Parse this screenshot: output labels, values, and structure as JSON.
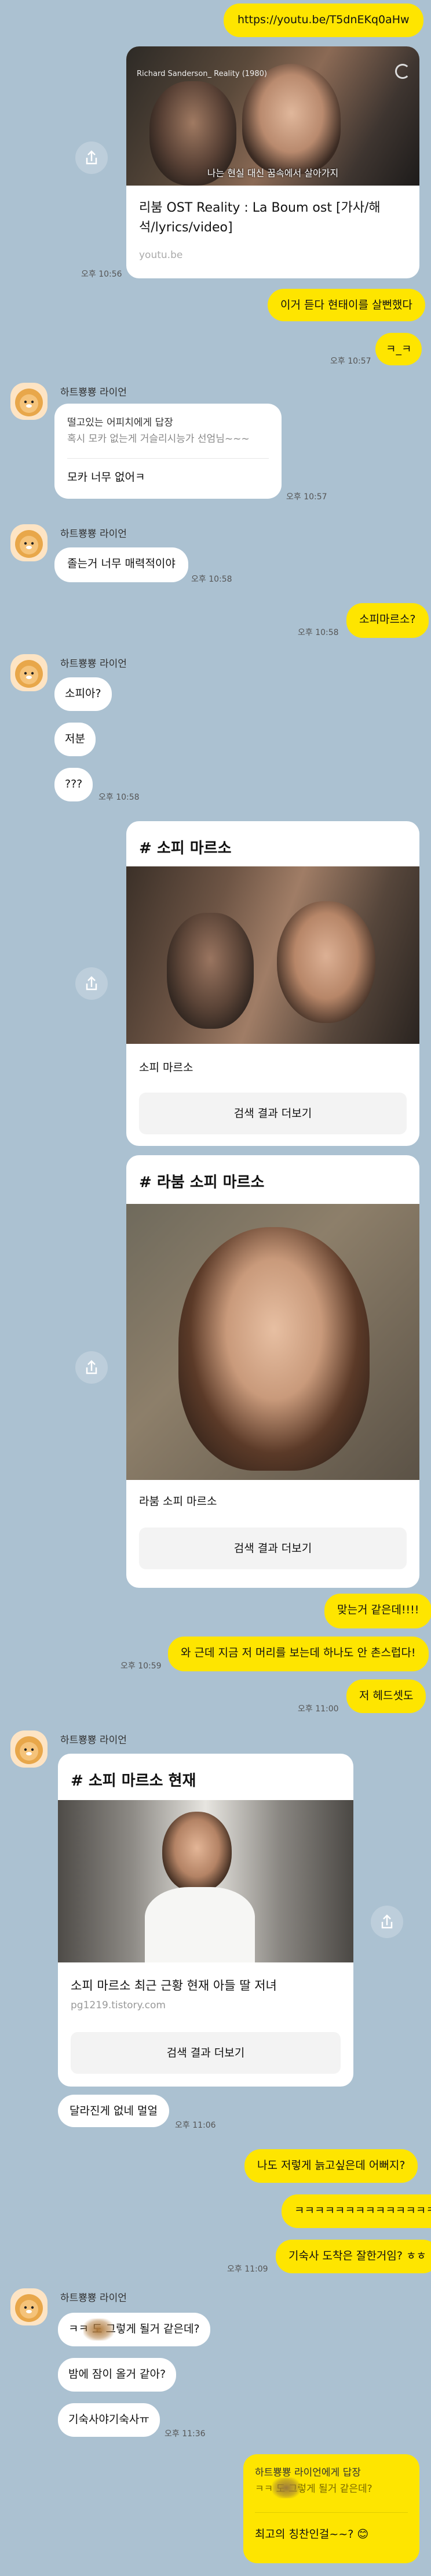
{
  "link_msg": {
    "url": "https://youtu.be/T5dnEKq0aHw",
    "video_overlay": "Richard Sanderson_ Reality (1980)",
    "subtitle": "나는 현실 대신 꿈속에서 살아가지",
    "title": "리붐 OST Reality : La Boum ost [가사/해석/lyrics/video]",
    "domain": "youtu.be",
    "time": "오후 10:56"
  },
  "msg_boom": {
    "text": "이거 듣다 현태이를 살뻔했다",
    "time": ""
  },
  "msg_kk": {
    "text": "ㅋ_ㅋ",
    "time": "오후 10:57"
  },
  "sender_name": "하트뿅뿅 라이언",
  "reply1": {
    "header": "떨고있는 어피치에게 답장",
    "quoted": "혹시 모카 없는게 거슬리시능가 선엄님~~~",
    "text": "모카 너무 없어ㅋ",
    "time": "오후 10:57"
  },
  "msg_charm": {
    "text": "졸는거 너무 매력적이야",
    "time": "오후 10:58"
  },
  "msg_sophie_q": {
    "text": "소피마르소?",
    "time": "오후 10:58"
  },
  "msg_sophia": {
    "text": "소피아?",
    "time": ""
  },
  "msg_jeo": {
    "text": "저분",
    "time": ""
  },
  "msg_qqq": {
    "text": "???",
    "time": "오후 10:58"
  },
  "card1": {
    "title": "# 소피 마르소",
    "caption": "소피 마르소",
    "button": "검색 결과 더보기"
  },
  "card2": {
    "title": "# 라붐 소피 마르소",
    "caption": "라붐 소피 마르소",
    "button": "검색 결과 더보기"
  },
  "msg_right": {
    "text": "맞는거 같은데!!!!",
    "time": ""
  },
  "msg_wow": {
    "text": "와 근데 지금 저 머리를 보는데 하나도 안 촌스럽다!",
    "time": "오후 10:59"
  },
  "msg_headset": {
    "text": "저 헤드셋도",
    "time": "오후 11:00"
  },
  "card3": {
    "title": "# 소피 마르소 현재",
    "headline": "소피 마르소 최근 근황 현재 아들 딸 저녀",
    "source": "pg1219.tistory.com",
    "button": "검색 결과 더보기"
  },
  "msg_different": {
    "text": "달라진게 없네 멀얼",
    "time": "오후 11:06"
  },
  "msg_me_too": {
    "text": "나도 저렇게 늙고싶은데 어뻐지?",
    "time": ""
  },
  "msg_kkk": {
    "text": "ㅋㅋㅋㅋㅋㅋㅋㅋㅋㅋㅋㅋㅋㅋ",
    "time": ""
  },
  "msg_dorm": {
    "text": "기숙사 도착은 잘한거임? ㅎㅎ",
    "time": "오후 11:09"
  },
  "msg_a1": {
    "text": "ㅋㅋ    도 그렇게 될거 같은데?",
    "time": ""
  },
  "msg_a2": {
    "text": "밤에 잠이 올거 같아?",
    "time": ""
  },
  "msg_a3": {
    "text": "기숙사야기숙사ㅠ",
    "time": "오후 11:36"
  },
  "reply2": {
    "header": "하트뿅뿅 라이언에게 답장",
    "quoted": "ㅋㅋ    도 그렇게 될거 같은데?",
    "text": "최고의 칭찬인걸~~? 😊"
  },
  "colors": {
    "me": "#fee500",
    "you": "#ffffff",
    "bg": "#abc1d1"
  }
}
